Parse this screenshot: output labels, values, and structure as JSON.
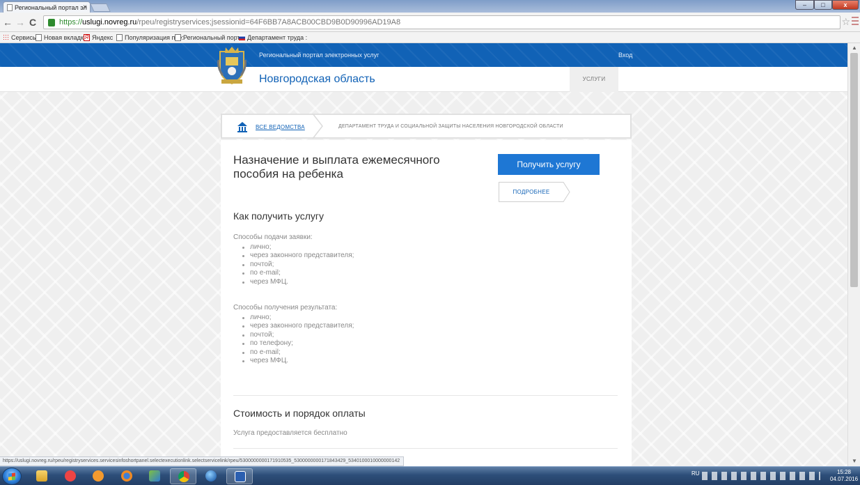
{
  "browser": {
    "tab_title": "Региональный портал эл",
    "tab_close": "×",
    "url_scheme": "https://",
    "url_host": "uslugi.novreg.ru",
    "url_path": "/rpeu/registryservices;jsessionid=64F6BB7A8ACB00CBD9B0D90996AD19A8",
    "nav": {
      "back": "←",
      "forward": "→",
      "reload": "C"
    },
    "star": "☆",
    "window_buttons": {
      "minimize": "–",
      "maximize": "□",
      "close": "x"
    },
    "bookmarks": [
      {
        "label": "Сервисы",
        "icon": "apps-icon"
      },
      {
        "label": "Новая вкладка",
        "icon": "page-icon"
      },
      {
        "label": "Яндекс",
        "icon": "yandex-icon",
        "icon_glyph": "Я"
      },
      {
        "label": "Популяризация пре:",
        "icon": "page-icon"
      },
      {
        "label": "Региональный портс",
        "icon": "page-icon"
      },
      {
        "label": "Департамент труда :",
        "icon": "russia-flag-icon"
      }
    ]
  },
  "site": {
    "portal_name": "Региональный портал электронных услуг",
    "login": "Вход",
    "region": "Новгородская область",
    "services_tab": "УСЛУГИ",
    "header_color": "#1162b6"
  },
  "breadcrumb": {
    "all": "ВСЕ ВЕДОМСТВА",
    "department": "ДЕПАРТАМЕНТ ТРУДА И СОЦИАЛЬНОЙ ЗАЩИТЫ НАСЕЛЕНИЯ НОВГОРОДСКОЙ ОБЛАСТИ"
  },
  "service": {
    "title": "Назначение и выплата ежемесячного пособия на ребенка",
    "get_button": "Получить услугу",
    "more_button": "ПОДРОБНЕЕ",
    "how_heading": "Как получить услугу",
    "submit_label": "Способы подачи заявки:",
    "submit_methods": [
      "лично;",
      "через законного представителя;",
      "почтой;",
      "по e-mail;",
      "через МФЦ."
    ],
    "result_label": "Способы получения результата:",
    "result_methods": [
      "лично;",
      "через законного представителя;",
      "почтой;",
      "по телефону;",
      "по e-mail;",
      "через МФЦ."
    ],
    "cost_heading": "Стоимость и порядок оплаты",
    "cost_text": "Услуга предоставляется бесплатно"
  },
  "status_url": "https://uslugi.novreg.ru/rpeu/registryservices.servicesinfoshortpanel.selectexecutionlink.selectservicelink/rpeu/5300000000171910535_5300000000171843429_5340100010000000142",
  "taskbar": {
    "apps": [
      "explorer-icon",
      "media-app-icon",
      "player-icon",
      "firefox-icon",
      "network-app-icon",
      "chrome-icon",
      "orb-app-icon",
      "word-icon"
    ],
    "language": "RU",
    "time": "15:28",
    "date": "04.07.2016"
  }
}
